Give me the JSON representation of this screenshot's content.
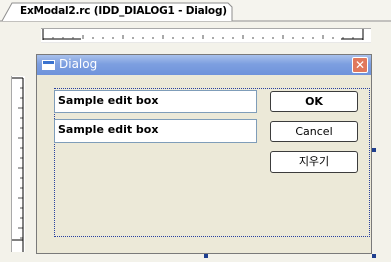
{
  "document_tab": {
    "title": "ExModal2.rc (IDD_DIALOG1 - Dialog)"
  },
  "dialog": {
    "title": "Dialog",
    "close_symbol": "✕",
    "title_icon": "window-icon",
    "edit_box_1": {
      "value": "Sample edit box"
    },
    "edit_box_2": {
      "value": "Sample edit box"
    },
    "buttons": {
      "ok": "OK",
      "cancel": "Cancel",
      "clear": "지우기"
    }
  },
  "colors": {
    "titlebar": "#7d9fe0",
    "dialog_background": "#ece9d8",
    "editor_background": "#f3f2ea",
    "close_button": "#e0785c",
    "selection_handles": "#1f3f8f"
  }
}
